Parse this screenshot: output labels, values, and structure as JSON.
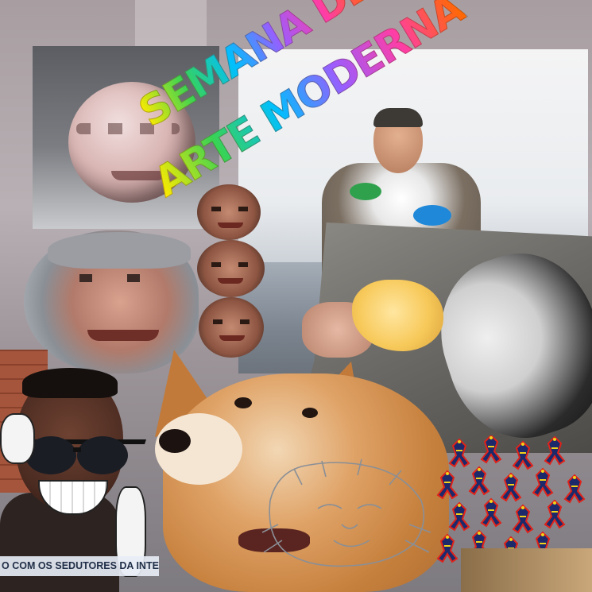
{
  "title": {
    "line1": "SEMANA DE",
    "line2": "ARTE MODERNA"
  },
  "ticker": {
    "text": "O COM OS SEDUTORES DA INTERNET"
  },
  "palette": {
    "wordart_gradient": [
      "#ffea00",
      "#39d353",
      "#00bfff",
      "#9b5cff",
      "#ff3ea5",
      "#ff6a00"
    ],
    "sky": "#eef0f2",
    "doge_fur": "#d99a5b",
    "ticker_bg": "#e6ecf5",
    "ticker_text": "#1f2e47"
  },
  "elements": [
    "sphere-face-icon",
    "bolsonaro-furry-costume",
    "rock-ball-with-bread",
    "gray-haired-face-coin",
    "stacked-faces-totem",
    "smiling-boy-with-sunglasses",
    "doge-shiba-icon",
    "lion-sketch-icon",
    "lizard-pattern-icon"
  ]
}
